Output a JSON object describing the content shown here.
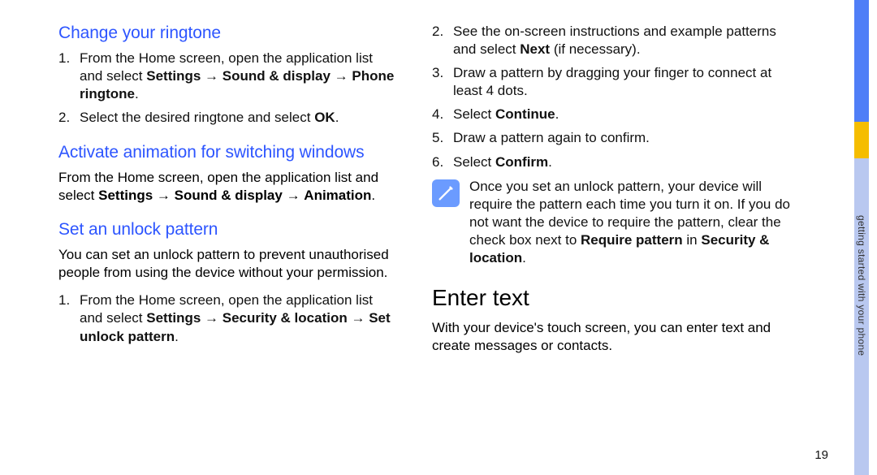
{
  "left": {
    "sec1": {
      "title": "Change your ringtone",
      "li1_a": "From the Home screen, open the application list and select ",
      "li1_b1": "Settings",
      "li1_arr1": " → ",
      "li1_b2": "Sound & display",
      "li1_arr2": " → ",
      "li1_b3": "Phone ringtone",
      "li1_c": ".",
      "li2_a": "Select the desired ringtone and select ",
      "li2_b": "OK",
      "li2_c": "."
    },
    "sec2": {
      "title": "Activate animation for switching windows",
      "p_a": "From the Home screen, open the application list and select ",
      "p_b1": "Settings",
      "p_arr1": " → ",
      "p_b2": "Sound & display",
      "p_arr2": " → ",
      "p_b3": "Animation",
      "p_c": "."
    },
    "sec3": {
      "title": "Set an unlock pattern",
      "intro": "You can set an unlock pattern to prevent unauthorised people from using the device without your permission.",
      "li1_a": "From the Home screen, open the application list and select ",
      "li1_b1": "Settings",
      "li1_arr1": " → ",
      "li1_b2": "Security & location",
      "li1_arr2": " → ",
      "li1_b3": "Set unlock pattern",
      "li1_c": "."
    }
  },
  "right": {
    "li2_a": "See the on-screen instructions and example patterns and select ",
    "li2_b": "Next",
    "li2_c": " (if necessary).",
    "li3": "Draw a pattern by dragging your finger to connect at least 4 dots.",
    "li4_a": "Select ",
    "li4_b": "Continue",
    "li4_c": ".",
    "li5": "Draw a pattern again to confirm.",
    "li6_a": "Select ",
    "li6_b": "Confirm",
    "li6_c": ".",
    "note_a": "Once you set an unlock pattern, your device will require the pattern each time you turn it on. If you do not want the device to require the pattern, clear the check box next to ",
    "note_b1": "Require pattern",
    "note_mid": " in ",
    "note_b2": "Security & location",
    "note_c": ".",
    "h2": "Enter text",
    "p2": "With your device's touch screen, you can enter text and create messages or contacts."
  },
  "tab_label": "getting started with your phone",
  "page_number": "19"
}
